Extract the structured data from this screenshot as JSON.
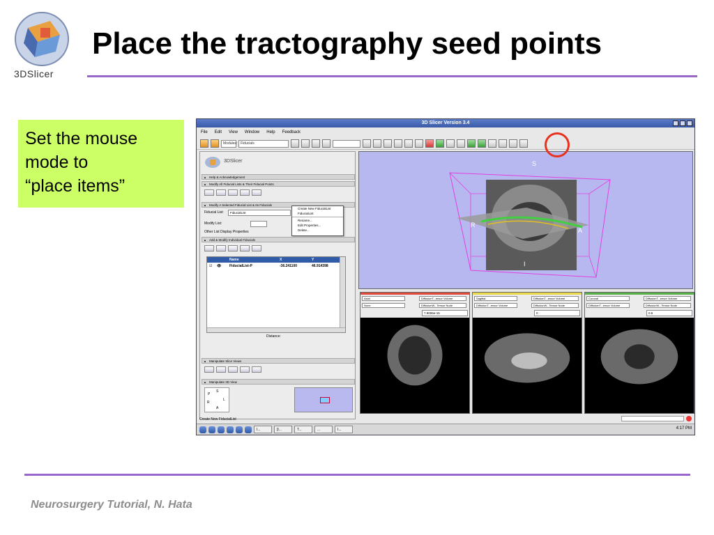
{
  "slide": {
    "title": "Place the tractography seed points",
    "logo_text": "3DSlicer",
    "callout_lines": [
      "Set the mouse",
      "mode to",
      "“place items”"
    ],
    "footer": "Neurosurgery Tutorial, N. Hata",
    "accent_color": "#9966cc",
    "callout_color": "#ccff66",
    "highlight_color": "#e8321e"
  },
  "app": {
    "window_title": "3D Slicer Version 3.4",
    "menu": [
      "File",
      "Edit",
      "View",
      "Window",
      "Help",
      "Feedback"
    ],
    "modules_label": "Modules:",
    "module_value": "Fiducials",
    "logo_text": "3DSlicer",
    "sections": {
      "help": "Help & Acknowledgement",
      "modify_all": "Modify All Fiducial Lists & Their Fiducial Points",
      "modify_selected": "Modify A Selected Fiducial List & Its Fiducials",
      "add_modify": "Add & Modify Individual Fiducials",
      "slice_views": "Manipulate Slice Views",
      "view3d": "Manipulate 3D View"
    },
    "fiducial_list_label": "Fiducial List:",
    "fiducial_list_value": "FiducialList",
    "modify_list_label": "Modify List:",
    "other_props_label": "Other List Display Properties",
    "popup_items": [
      "Create New FiducialList",
      "FiducialList",
      "Rename...",
      "Edit Properties...",
      "Delete..."
    ],
    "table": {
      "columns": [
        "Name",
        "X",
        "Y"
      ],
      "row": {
        "name": "FiducialList-P",
        "x": "-36.241100",
        "y": "46.914398"
      }
    },
    "distance_label": "Distance:",
    "axes_labels": {
      "p": "P",
      "s": "S",
      "l": "L",
      "r": "R",
      "a": "A",
      "i": "I"
    },
    "view3d_labels": {
      "s": "S",
      "r": "R",
      "a": "A",
      "i": "I"
    },
    "slices": [
      {
        "orientation": "Axial",
        "bg": "DiffusionT...ensor Volume",
        "fg": "None",
        "lbl": "DiffusionW...Tensor Node",
        "value": "7.9006e-15",
        "color": "#e04a3a"
      },
      {
        "orientation": "Sagittal",
        "bg": "DiffusionT...ensor Volume",
        "fg": "DiffusionT...ensor Volume",
        "lbl": "DiffusionW...Tensor Node",
        "value": "0",
        "color": "#e8d84a"
      },
      {
        "orientation": "Coronal",
        "bg": "DiffusionT...ensor Volume",
        "fg": "DiffusionT...ensor Volume",
        "lbl": "DiffusionW...Tensor Node",
        "value": "0.5",
        "color": "#5ab04a"
      }
    ],
    "status_text": "Create New FiducialList",
    "taskbar": [
      "I...",
      "[I...",
      "T...",
      "...",
      "I..."
    ],
    "clock": "4:17 PM"
  }
}
